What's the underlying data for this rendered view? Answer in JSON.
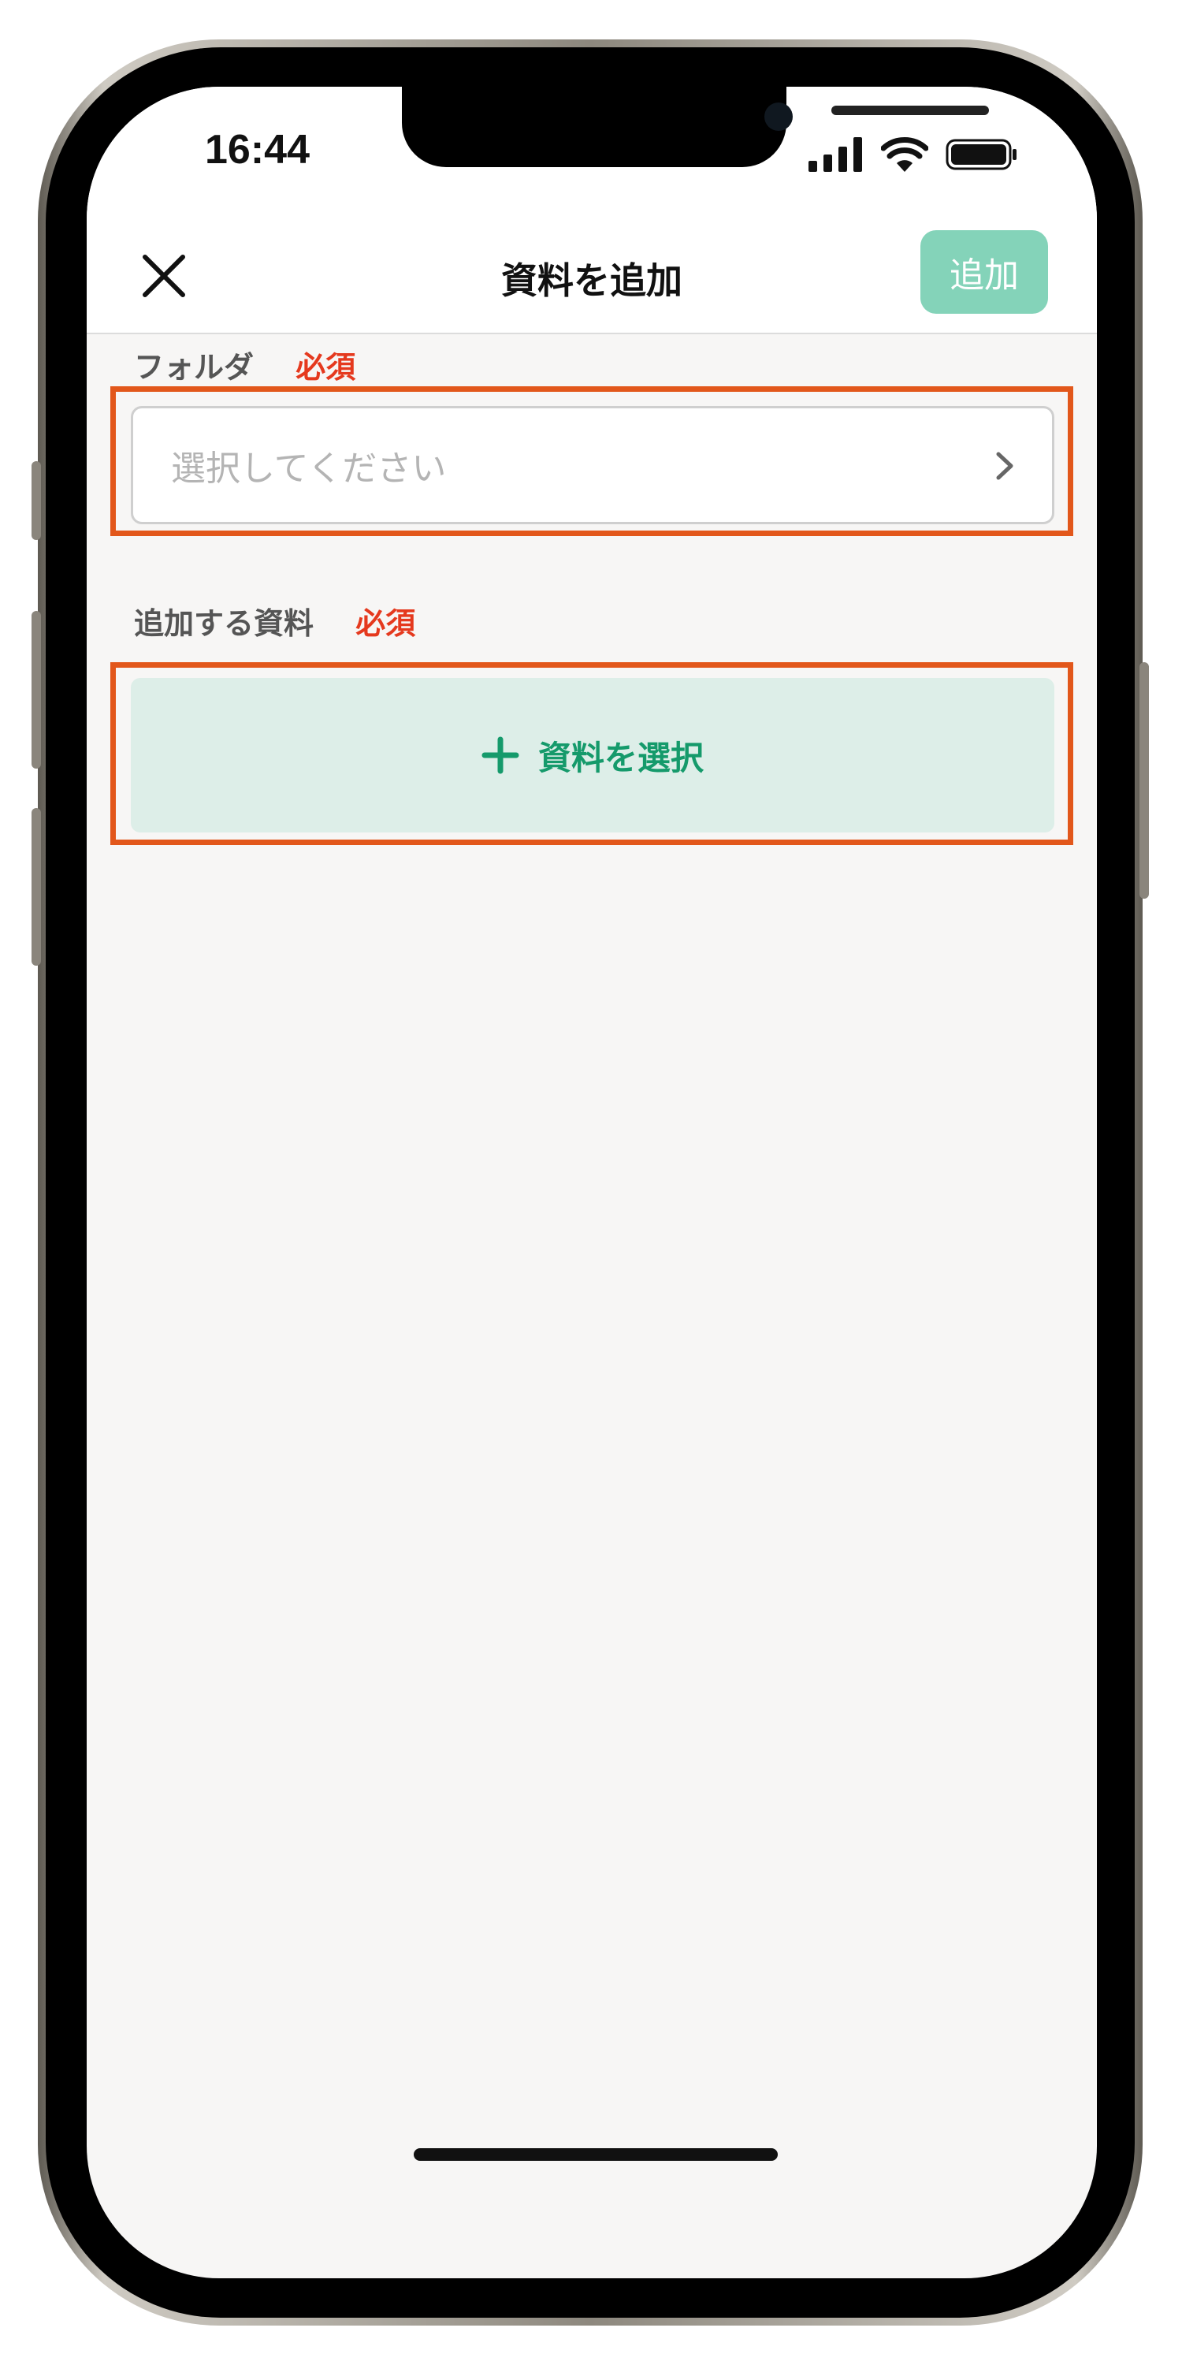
{
  "status_bar": {
    "time": "16:44",
    "icons": [
      "signal-icon",
      "wifi-icon",
      "battery-icon"
    ]
  },
  "header": {
    "title": "資料を追加",
    "close_icon": "close-icon",
    "add_label": "追加"
  },
  "form": {
    "folder": {
      "label": "フォルダ",
      "required": "必須",
      "placeholder": "選択してください",
      "chevron_icon": "chevron-right-icon"
    },
    "material": {
      "label": "追加する資料",
      "required": "必須",
      "button_label": "資料を選択",
      "button_icon": "plus-icon"
    }
  },
  "colors": {
    "accent_green": "#159a6b",
    "add_button_bg": "#84d3b9",
    "required_red": "#e5391e",
    "highlight_orange": "#e2571b",
    "pick_button_bg": "#ddeee8"
  }
}
